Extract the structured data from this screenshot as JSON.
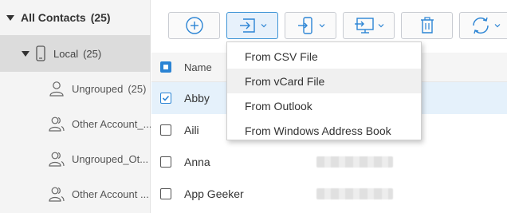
{
  "sidebar": {
    "all_contacts": {
      "label": "All Contacts",
      "count": "(25)"
    },
    "local": {
      "label": "Local",
      "count": "(25)"
    },
    "groups": [
      {
        "label": "Ungrouped",
        "count": "(25)"
      },
      {
        "label": "Other Account_...",
        "count": ""
      },
      {
        "label": "Ungrouped_Ot...",
        "count": ""
      },
      {
        "label": "Other Account ...",
        "count": ""
      }
    ]
  },
  "toolbar": {
    "buttons": [
      "add-icon",
      "import-icon",
      "export-to-device-icon",
      "export-to-computer-icon",
      "delete-icon",
      "sync-icon"
    ]
  },
  "table": {
    "header_name": "Name",
    "rows": [
      {
        "name": "Abby",
        "checked": true
      },
      {
        "name": "Aili",
        "checked": false
      },
      {
        "name": "Anna",
        "checked": false
      },
      {
        "name": "App Geeker",
        "checked": false
      }
    ]
  },
  "import_menu": {
    "items": [
      "From CSV File",
      "From vCard File",
      "From Outlook",
      "From Windows Address Book"
    ]
  },
  "colors": {
    "accent": "#2b84d4",
    "selected_row": "#e5f1fb",
    "sidebar_bg": "#f4f4f4",
    "sidebar_selected": "#dcdcdc"
  }
}
